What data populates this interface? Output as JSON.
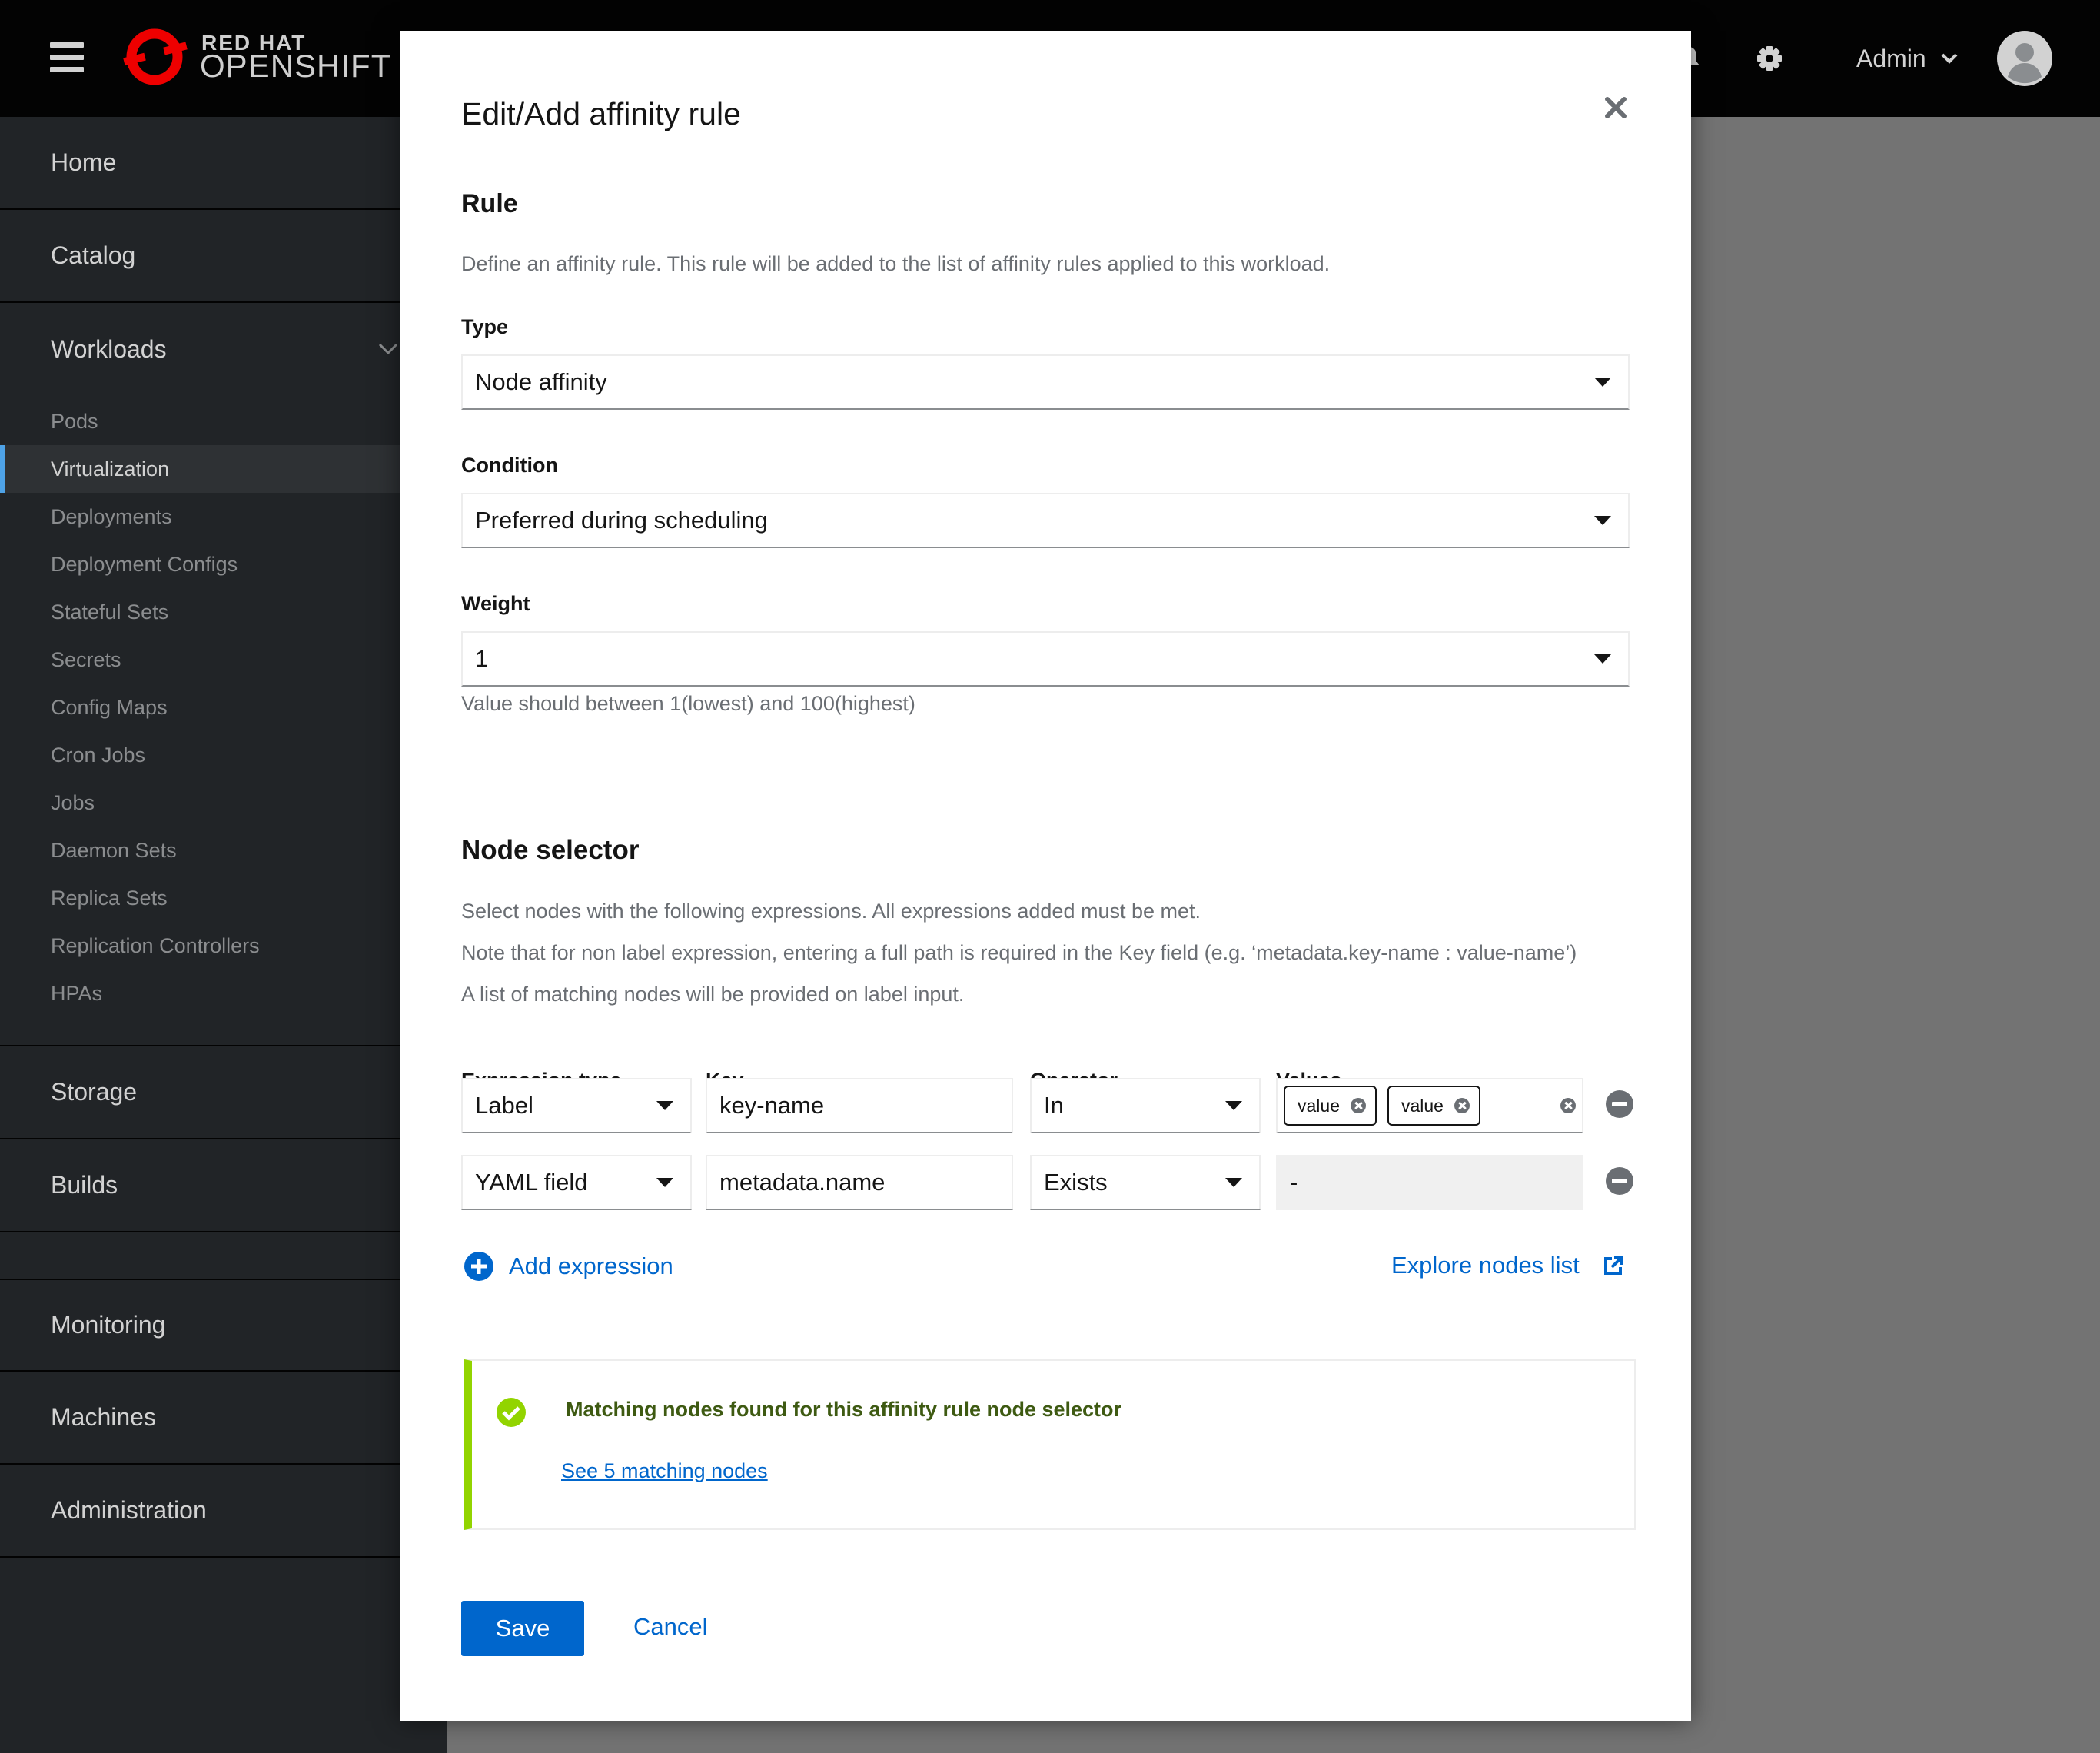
{
  "masthead": {
    "brand_small": "RED HAT",
    "brand_big": "OPENSHIFT",
    "user_label": "Admin"
  },
  "sidebar": {
    "sections_top": [
      {
        "label": "Home"
      },
      {
        "label": "Catalog"
      }
    ],
    "workloads_label": "Workloads",
    "workloads_items": [
      {
        "label": "Pods"
      },
      {
        "label": "Virtualization"
      },
      {
        "label": "Deployments"
      },
      {
        "label": "Deployment Configs"
      },
      {
        "label": "Stateful Sets"
      },
      {
        "label": "Secrets"
      },
      {
        "label": "Config Maps"
      },
      {
        "label": "Cron Jobs"
      },
      {
        "label": "Jobs"
      },
      {
        "label": "Daemon Sets"
      },
      {
        "label": "Replica Sets"
      },
      {
        "label": "Replication Controllers"
      },
      {
        "label": "HPAs"
      }
    ],
    "sections_bottom": [
      {
        "label": "Storage"
      },
      {
        "label": "Builds"
      },
      {
        "label": "Monitoring"
      },
      {
        "label": "Machines"
      },
      {
        "label": "Administration"
      }
    ]
  },
  "modal": {
    "title": "Edit/Add affinity rule",
    "rule_heading": "Rule",
    "rule_desc": "Define an affinity rule. This rule will be added to the list of affinity rules applied to this workload.",
    "type_label": "Type",
    "type_value": "Node affinity",
    "condition_label": "Condition",
    "condition_value": "Preferred during scheduling",
    "weight_label": "Weight",
    "weight_value": "1",
    "weight_help": "Value should between 1(lowest) and 100(highest)",
    "node_selector_heading": "Node selector",
    "ns_desc1": "Select nodes with the following expressions. All expressions added must be met.",
    "ns_desc2": "Note that for non label expression, entering a full path is required in the Key field (e.g. ‘metadata.key-name : value-name’)",
    "ns_desc3": "A list of matching nodes will be provided on label input.",
    "columns": {
      "expression_type": "Expression type",
      "key": "Key",
      "operator": "Operator",
      "values": "Values"
    },
    "rows": [
      {
        "type": "Label",
        "key": "key-name",
        "operator": "In",
        "values": [
          "value",
          "value"
        ]
      },
      {
        "type": "YAML field",
        "key": "metadata.name",
        "operator": "Exists",
        "values_placeholder": "-"
      }
    ],
    "add_expression": "Add expression",
    "explore_nodes": "Explore nodes list",
    "alert": {
      "title": "Matching nodes found for this affinity rule node selector",
      "link": "See 5 matching nodes"
    },
    "save": "Save",
    "cancel": "Cancel"
  },
  "colors": {
    "accent": "#0066cc",
    "success": "#92d400",
    "masthead": "#030303",
    "sidebar": "#212427"
  }
}
